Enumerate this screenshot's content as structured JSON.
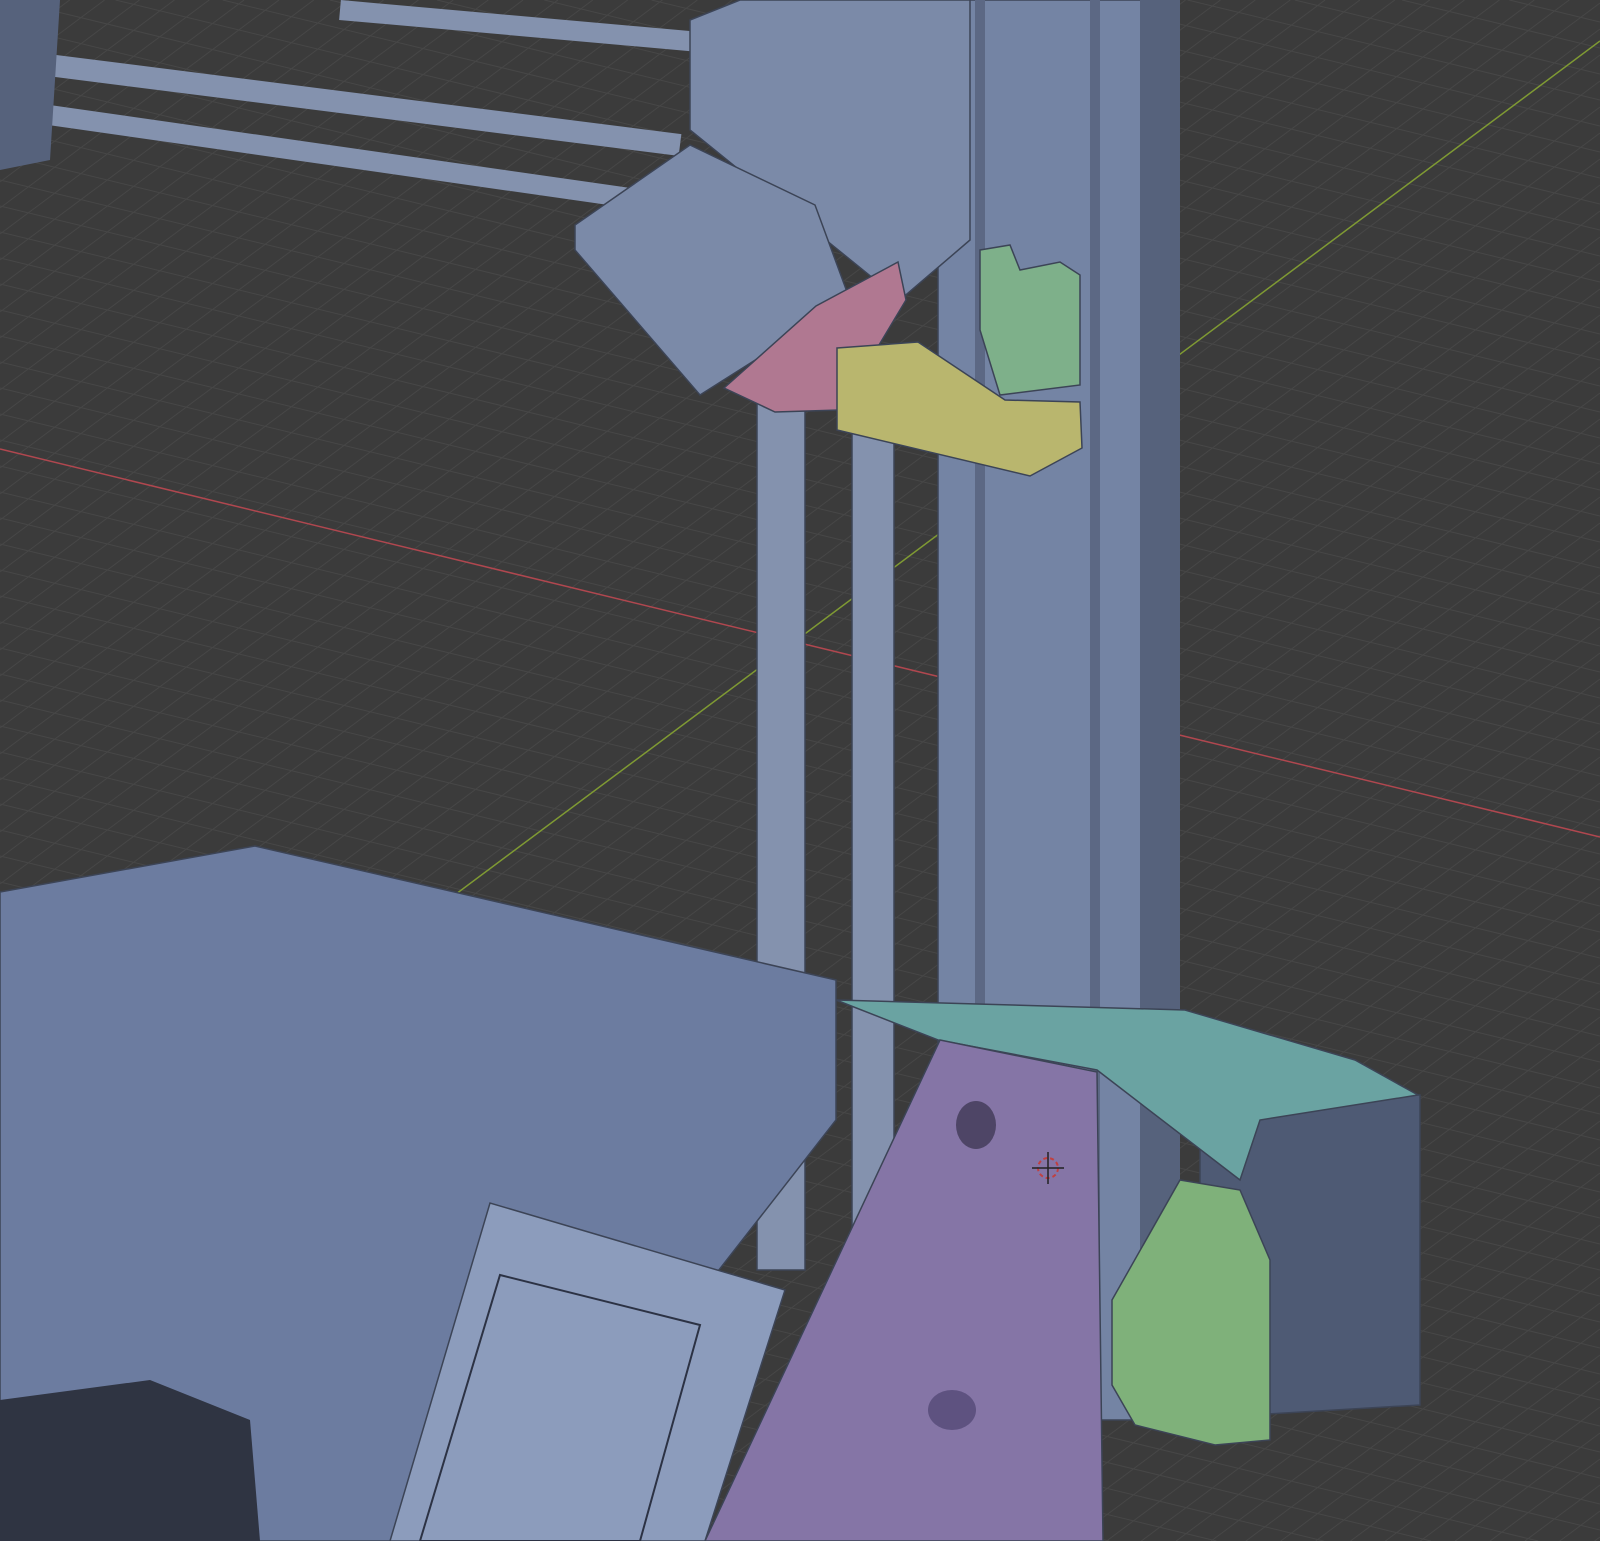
{
  "viewport": {
    "background_color": "#3b3b3b",
    "grid_color": "#474747",
    "x_axis_color": "#b0474f",
    "y_axis_color": "#7f9a33"
  },
  "model": {
    "frame_color": "#7484a4",
    "frame_shadow_color": "#56627c",
    "rod_color": "#8492ae",
    "motor_color": "#7b8aa8",
    "bed_color": "#6c7ca0",
    "lcd_color": "#8c9cbc",
    "bracket_color": "#8575a6",
    "base_color": "#6aa3a2",
    "base_box_color": "#4e5a74",
    "pink_part_color": "#b07891",
    "yellow_part_color": "#b9b66e",
    "green_clip_color": "#7eb08a",
    "green_clip_bottom_color": "#7fb17a"
  }
}
